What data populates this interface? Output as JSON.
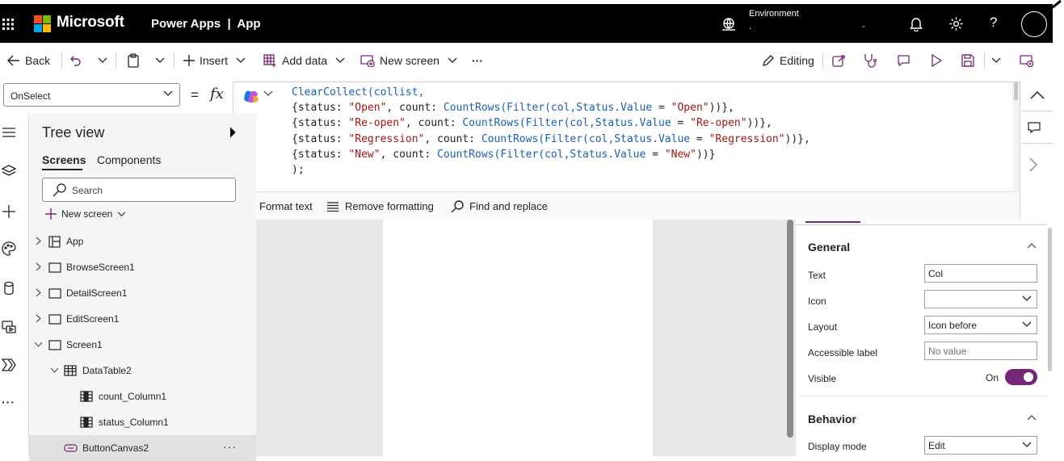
{
  "topbar": {
    "brand": "Microsoft",
    "app_title": "Power Apps  |  App",
    "environment_label": "Environment",
    "environment_value": ".",
    "environment_extra": "-",
    "help": "?"
  },
  "commandbar": {
    "back": "Back",
    "insert": "Insert",
    "add_data": "Add data",
    "new_screen": "New screen",
    "more": "···",
    "editing": "Editing"
  },
  "formula": {
    "property": "OnSelect",
    "equals": "=",
    "fx": "fx",
    "lines": [
      [
        {
          "t": "ClearCollect(collist,",
          "c": "cf"
        }
      ],
      [
        {
          "t": "{status: ",
          "c": "cp"
        },
        {
          "t": "\"Open\"",
          "c": "cs"
        },
        {
          "t": ", count: ",
          "c": "cp"
        },
        {
          "t": "CountRows(Filter(col,Status.Value",
          "c": "cf"
        },
        {
          "t": " = ",
          "c": "cp"
        },
        {
          "t": "\"Open\"",
          "c": "cs"
        },
        {
          "t": "))},",
          "c": "cp"
        }
      ],
      [
        {
          "t": "{status: ",
          "c": "cp"
        },
        {
          "t": "\"Re-open\"",
          "c": "cs"
        },
        {
          "t": ", count: ",
          "c": "cp"
        },
        {
          "t": "CountRows(Filter(col,Status.Value",
          "c": "cf"
        },
        {
          "t": " = ",
          "c": "cp"
        },
        {
          "t": "\"Re-open\"",
          "c": "cs"
        },
        {
          "t": "))},",
          "c": "cp"
        }
      ],
      [
        {
          "t": "{status: ",
          "c": "cp"
        },
        {
          "t": "\"Regression\"",
          "c": "cs"
        },
        {
          "t": ", count: ",
          "c": "cp"
        },
        {
          "t": "CountRows(Filter(col,Status.Value",
          "c": "cf"
        },
        {
          "t": " = ",
          "c": "cp"
        },
        {
          "t": "\"Regression\"",
          "c": "cs"
        },
        {
          "t": "))},",
          "c": "cp"
        }
      ],
      [
        {
          "t": "{status: ",
          "c": "cp"
        },
        {
          "t": "\"New\"",
          "c": "cs"
        },
        {
          "t": ", count: ",
          "c": "cp"
        },
        {
          "t": "CountRows(Filter(col,Status.Value",
          "c": "cf"
        },
        {
          "t": " = ",
          "c": "cp"
        },
        {
          "t": "\"New\"",
          "c": "cs"
        },
        {
          "t": "))}",
          "c": "cp"
        }
      ],
      [
        {
          "t": ");",
          "c": "cp"
        }
      ]
    ],
    "format_text": "Format text",
    "remove_formatting": "Remove formatting",
    "find_replace": "Find and replace"
  },
  "tree": {
    "title": "Tree view",
    "tab_screens": "Screens",
    "tab_components": "Components",
    "search_placeholder": "Search",
    "new_screen": "New screen",
    "nodes": {
      "app": "App",
      "browse": "BrowseScreen1",
      "detail": "DetailScreen1",
      "edit": "EditScreen1",
      "screen1": "Screen1",
      "datatable": "DataTable2",
      "count_col": "count_Column1",
      "status_col": "status_Column1",
      "button": "ButtonCanvas2"
    },
    "more": "···"
  },
  "properties": {
    "general": "General",
    "text_label": "Text",
    "text_value": "Col",
    "icon_label": "Icon",
    "layout_label": "Layout",
    "layout_value": "Icon before",
    "accessible_label": "Accessible label",
    "accessible_placeholder": "No value",
    "visible_label": "Visible",
    "visible_value": "On",
    "behavior": "Behavior",
    "display_mode_label": "Display mode",
    "display_mode_value": "Edit"
  },
  "colors": {
    "accent": "#742774",
    "topbar_bg": "#000000",
    "code_function": "#1a5fb4",
    "code_string": "#a31515"
  }
}
